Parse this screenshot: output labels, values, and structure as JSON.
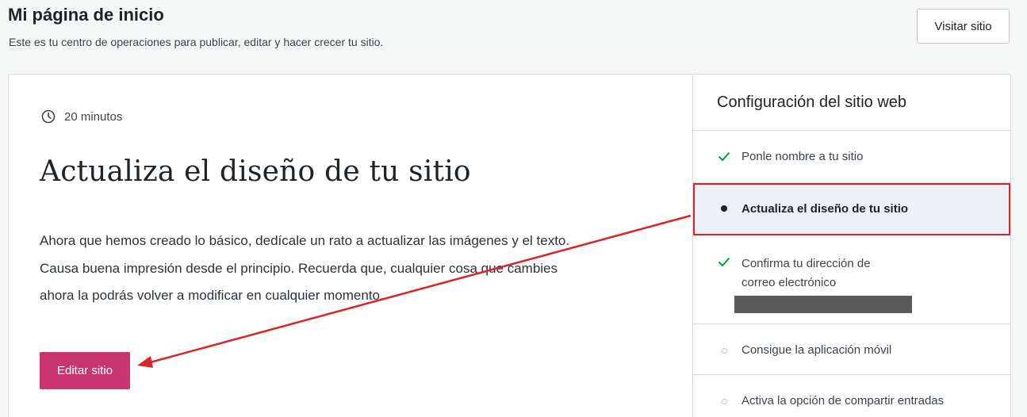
{
  "header": {
    "title": "Mi página de inicio",
    "subtitle": "Este es tu centro de operaciones para publicar, editar y hacer crecer tu sitio.",
    "visit_site_label": "Visitar sitio"
  },
  "task": {
    "duration": "20 minutos",
    "title": "Actualiza el diseño de tu sitio",
    "description_lines": [
      "Ahora que hemos creado lo básico, dedícale un rato a actualizar las imágenes y el texto.",
      "Causa buena impresión desde el principio. Recuerda que, cualquier cosa que cambies",
      "ahora la podrás volver a modificar en cualquier momento."
    ],
    "edit_button_label": "Editar sitio"
  },
  "checklist": {
    "title": "Configuración del sitio web",
    "items": [
      {
        "label": "Ponle nombre a tu sitio",
        "status": "completed",
        "icon": "check-icon"
      },
      {
        "label": "Actualiza el diseño de tu sitio",
        "status": "current",
        "icon": "dot-icon"
      },
      {
        "label_lines": [
          "Confirma tu dirección de",
          "correo electrónico"
        ],
        "status": "completed",
        "icon": "check-icon",
        "redacted": true
      },
      {
        "label": "Consigue la aplicación móvil",
        "status": "pending",
        "icon": "circle-icon"
      },
      {
        "label": "Activa la opción de compartir entradas",
        "status": "pending",
        "icon": "circle-icon"
      }
    ]
  },
  "colors": {
    "accent_pink": "#c9356e",
    "check_green": "#00a32a",
    "annotation_red": "#d9242a",
    "highlight_bg": "#eef0f9"
  }
}
